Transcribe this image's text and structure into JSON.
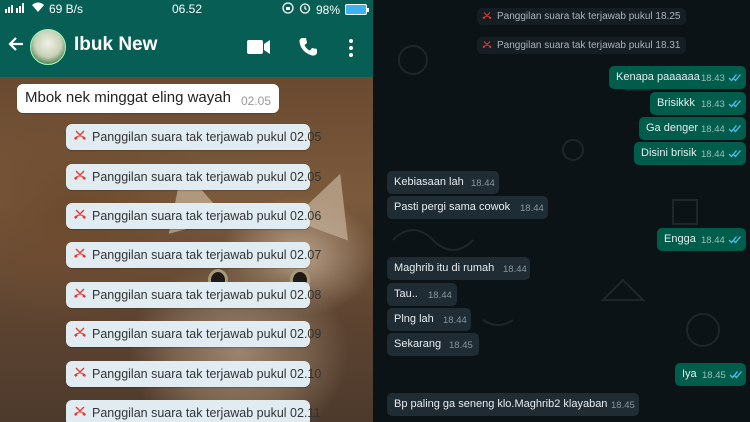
{
  "status_bar": {
    "network": "69 B/s",
    "time": "06.52",
    "battery": "98%"
  },
  "header": {
    "contact_name": "Ibuk New"
  },
  "left_chat": {
    "text_message": {
      "text": "Mbok nek minggat eling wayah",
      "time": "02.05"
    },
    "missed_calls": [
      {
        "text": "Panggilan suara tak terjawab pukul 02.05"
      },
      {
        "text": "Panggilan suara tak terjawab pukul 02.05"
      },
      {
        "text": "Panggilan suara tak terjawab pukul 02.06"
      },
      {
        "text": "Panggilan suara tak terjawab pukul 02.07"
      },
      {
        "text": "Panggilan suara tak terjawab pukul 02.08"
      },
      {
        "text": "Panggilan suara tak terjawab pukul 02.09"
      },
      {
        "text": "Panggilan suara tak terjawab pukul 02.10"
      },
      {
        "text": "Panggilan suara tak terjawab pukul 02.11"
      }
    ]
  },
  "right_chat": {
    "missed_calls": [
      {
        "text": "Panggilan suara tak terjawab pukul 18.25"
      },
      {
        "text": "Panggilan suara tak terjawab pukul 18.31"
      }
    ],
    "messages": [
      {
        "dir": "out",
        "text": "Kenapa paaaaaa",
        "time": "18.43"
      },
      {
        "dir": "out",
        "text": "Brisikkk",
        "time": "18.43"
      },
      {
        "dir": "out",
        "text": "Ga denger",
        "time": "18.44"
      },
      {
        "dir": "out",
        "text": "Disini brisik",
        "time": "18.44"
      },
      {
        "dir": "in",
        "text": "Kebiasaan lah",
        "time": "18.44"
      },
      {
        "dir": "in",
        "text": "Pasti pergi sama cowok",
        "time": "18.44"
      },
      {
        "dir": "out",
        "text": "Engga",
        "time": "18.44"
      },
      {
        "dir": "in",
        "text": "Maghrib itu di rumah",
        "time": "18.44"
      },
      {
        "dir": "in",
        "text": "Tau..",
        "time": "18.44"
      },
      {
        "dir": "in",
        "text": "Plng lah",
        "time": "18.44"
      },
      {
        "dir": "in",
        "text": "Sekarang",
        "time": "18.45"
      },
      {
        "dir": "out",
        "text": "Iya",
        "time": "18.45"
      },
      {
        "dir": "in",
        "text": "Bp paling ga seneng klo.Maghrib2 klayaban",
        "time": "18.45"
      }
    ]
  },
  "colors": {
    "header_green": "#075e54",
    "outgoing_bubble": "#005c4b",
    "incoming_bubble_dark": "#1f2c34",
    "missed_call_red": "#e53935",
    "read_tick_blue": "#53bdeb"
  }
}
